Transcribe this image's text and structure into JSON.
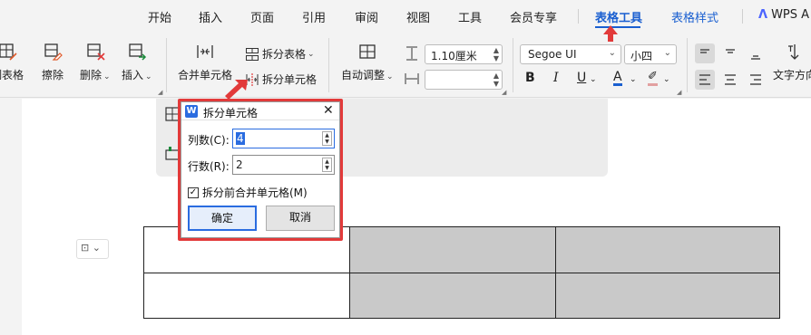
{
  "menubar": {
    "items": [
      "开始",
      "插入",
      "页面",
      "引用",
      "审阅",
      "视图",
      "工具",
      "会员专享",
      "表格工具",
      "表格样式"
    ],
    "active": "表格工具",
    "wps_ai": "WPS A"
  },
  "ribbon": {
    "draw_table": "制表格",
    "erase": "擦除",
    "delete": "删除",
    "insert": "插入",
    "merge_cells": "合并单元格",
    "split_table": "拆分表格",
    "split_cells": "拆分单元格",
    "auto_fit": "自动调整",
    "row_height": "1.10厘米",
    "col_width": "",
    "font_name": "Segoe UI",
    "font_size": "小四",
    "text_direction": "文字方向"
  },
  "dialog": {
    "title": "拆分单元格",
    "columns_label": "列数(C):",
    "columns_value": "4",
    "rows_label": "行数(R):",
    "rows_value": "2",
    "merge_before_split_label": "拆分前合并单元格(M)",
    "merge_before_split_checked": true,
    "ok_label": "确定",
    "cancel_label": "取消"
  },
  "colors": {
    "accent": "#1a5fd0",
    "highlight_frame": "#e23a3a",
    "cell_shade": "#c9c9c9"
  }
}
